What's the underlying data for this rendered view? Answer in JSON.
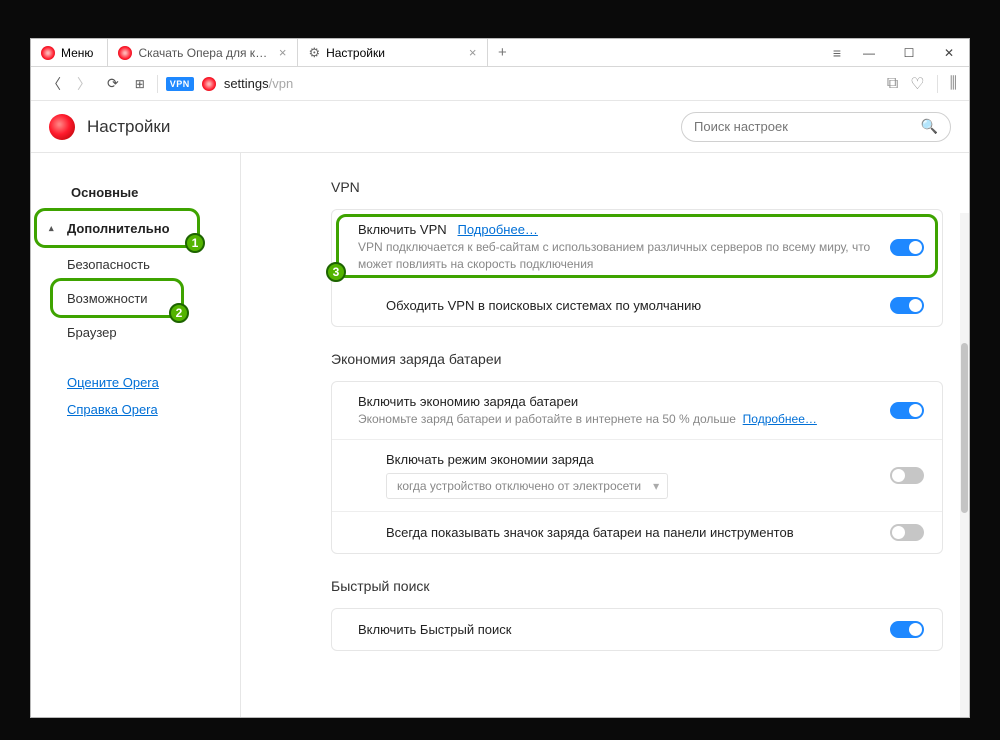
{
  "menu_label": "Меню",
  "tabs": [
    {
      "label": "Скачать Опера для ком...",
      "active": false
    },
    {
      "label": "Настройки",
      "active": true
    }
  ],
  "address": {
    "vpn_badge": "VPN",
    "path_prefix": "settings",
    "path_suffix": "/vpn"
  },
  "settings_header": {
    "title": "Настройки",
    "search_placeholder": "Поиск настроек"
  },
  "sidebar": {
    "basic": "Основные",
    "advanced": "Дополнительно",
    "security": "Безопасность",
    "features": "Возможности",
    "browser": "Браузер",
    "rate": "Оцените Opera",
    "help": "Справка Opera"
  },
  "badges": {
    "one": "1",
    "two": "2",
    "three": "3"
  },
  "sections": {
    "vpn": {
      "title": "VPN",
      "enable_label": "Включить VPN",
      "learn_more": "Подробнее…",
      "desc": "VPN подключается к веб-сайтам с использованием различных серверов по всему миру, что может повлиять на скорость подключения",
      "bypass_label": "Обходить VPN в поисковых системах по умолчанию"
    },
    "battery": {
      "title": "Экономия заряда батареи",
      "enable_label": "Включить экономию заряда батареи",
      "desc_prefix": "Экономьте заряд батареи и работайте в интернете на 50 % дольше",
      "learn_more": "Подробнее…",
      "mode_label": "Включать режим экономии заряда",
      "dropdown_value": "когда устройство отключено от электросети",
      "always_icon_label": "Всегда показывать значок заряда батареи на панели инструментов"
    },
    "quick": {
      "title": "Быстрый поиск",
      "enable_label": "Включить Быстрый поиск"
    }
  }
}
